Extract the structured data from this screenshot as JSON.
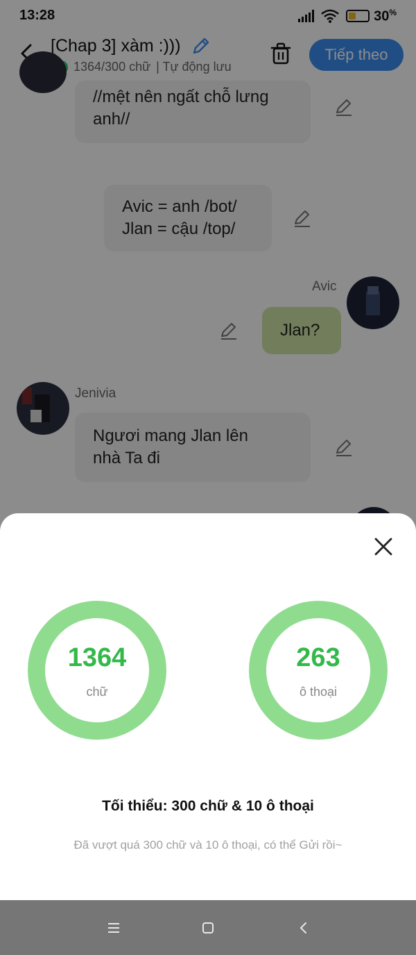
{
  "status_bar": {
    "time": "13:28",
    "battery_percent": "30",
    "battery_unit": "%"
  },
  "header": {
    "title": "[Chap 3] xàm :)))",
    "word_count": "1364/300 chữ",
    "autosave": "| Tự động lưu",
    "next_label": "Tiếp theo"
  },
  "messages": [
    {
      "text_lines": [
        "//mệt nên ngất chỗ lưng",
        "anh//"
      ]
    },
    {
      "text_lines": [
        "Avic = anh /bot/",
        "Jlan = cậu /top/"
      ]
    },
    {
      "sender": "Avic",
      "text_lines": [
        "Jlan?"
      ]
    },
    {
      "sender": "Jenivia",
      "text_lines": [
        "Ngươi mang Jlan lên",
        "nhà Ta đi"
      ]
    }
  ],
  "sheet": {
    "stats": [
      {
        "number": "1364",
        "label": "chữ"
      },
      {
        "number": "263",
        "label": "ô thoại"
      }
    ],
    "minimum": "Tối thiểu: 300 chữ & 10 ô thoại",
    "hint": "Đã vượt quá 300 chữ và 10 ô thoại, có thể Gửi rồi~"
  },
  "colors": {
    "accent": "#3b8ff0",
    "success": "#33b84a",
    "ring": "#8fdc8f",
    "own_bubble": "#cfe6a6"
  }
}
